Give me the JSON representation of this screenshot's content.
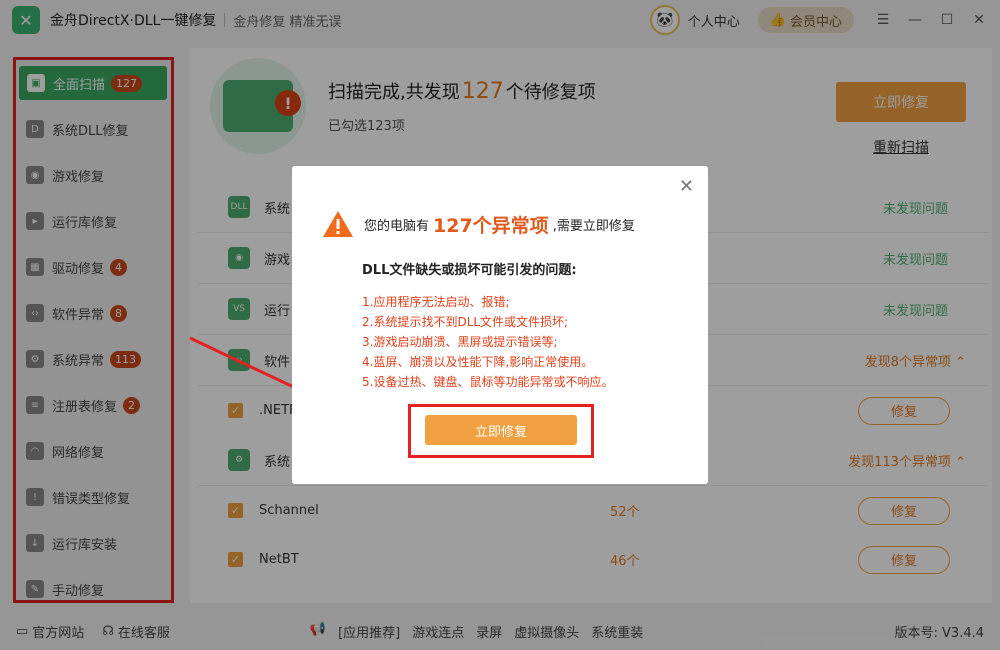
{
  "window": {
    "title": "金舟DirectX·DLL一键修复",
    "slogan": "金舟修复 精准无误",
    "personal_center": "个人中心",
    "vip_center": "会员中心"
  },
  "sidebar": {
    "items": [
      {
        "label": "全面扫描",
        "badge": "127",
        "icon": "scan-icon"
      },
      {
        "label": "系统DLL修复",
        "badge": "",
        "icon": "dll-icon"
      },
      {
        "label": "游戏修复",
        "badge": "",
        "icon": "gamepad-icon"
      },
      {
        "label": "运行库修复",
        "badge": "",
        "icon": "runtime-icon"
      },
      {
        "label": "驱动修复",
        "badge": "4",
        "icon": "driver-icon"
      },
      {
        "label": "软件异常",
        "badge": "8",
        "icon": "code-icon"
      },
      {
        "label": "系统异常",
        "badge": "113",
        "icon": "gear-icon"
      },
      {
        "label": "注册表修复",
        "badge": "2",
        "icon": "list-icon"
      },
      {
        "label": "网络修复",
        "badge": "",
        "icon": "wifi-icon"
      },
      {
        "label": "错误类型修复",
        "badge": "",
        "icon": "warning-icon"
      },
      {
        "label": "运行库安装",
        "badge": "",
        "icon": "install-icon"
      },
      {
        "label": "手动修复",
        "badge": "",
        "icon": "wrench-icon"
      }
    ]
  },
  "scan": {
    "title_prefix": "扫描完成,共发现",
    "count": "127",
    "title_suffix": "个待修复项",
    "selected": "已勾选123项",
    "fix_now": "立即修复",
    "rescan": "重新扫描"
  },
  "list": {
    "rows": [
      {
        "name": "系统",
        "status": "未发现问题",
        "icon": "DLL"
      },
      {
        "name": "游戏",
        "status": "未发现问题",
        "icon": "game"
      },
      {
        "name": "运行",
        "status": "未发现问题",
        "icon": "vs"
      },
      {
        "name": "软件",
        "status": "发现8个异常项",
        "icon": "code"
      }
    ],
    "net_row": {
      "name": ".NETF",
      "repair": "修复"
    },
    "sys_row": {
      "name": "系统",
      "status": "发现113个异常项"
    },
    "sub_rows": [
      {
        "name": "Schannel",
        "count": "52个",
        "repair": "修复"
      },
      {
        "name": "NetBT",
        "count": "46个",
        "repair": "修复"
      }
    ]
  },
  "dialog": {
    "head_prefix": "您的电脑有",
    "head_count": "127个异常项",
    "head_suffix": ",需要立即修复",
    "question": "DLL文件缺失或损坏可能引发的问题:",
    "issues": [
      "1.应用程序无法启动、报错;",
      "2.系统提示找不到DLL文件或文件损坏;",
      "3.游戏启动崩溃、黑屏或提示错误等;",
      "4.蓝屏、崩溃以及性能下降,影响正常使用。",
      "5.设备过热、键盘、鼠标等功能异常或不响应。"
    ],
    "button": "立即修复"
  },
  "footer": {
    "website": "官方网站",
    "service": "在线客服",
    "links": [
      "[应用推荐]",
      "游戏连点",
      "录屏",
      "虚拟摄像头",
      "系统重装"
    ],
    "version": "版本号: V3.4.4"
  },
  "colors": {
    "accent_green": "#3aaa62",
    "accent_orange": "#f0a040",
    "alert_red": "#e32222"
  }
}
